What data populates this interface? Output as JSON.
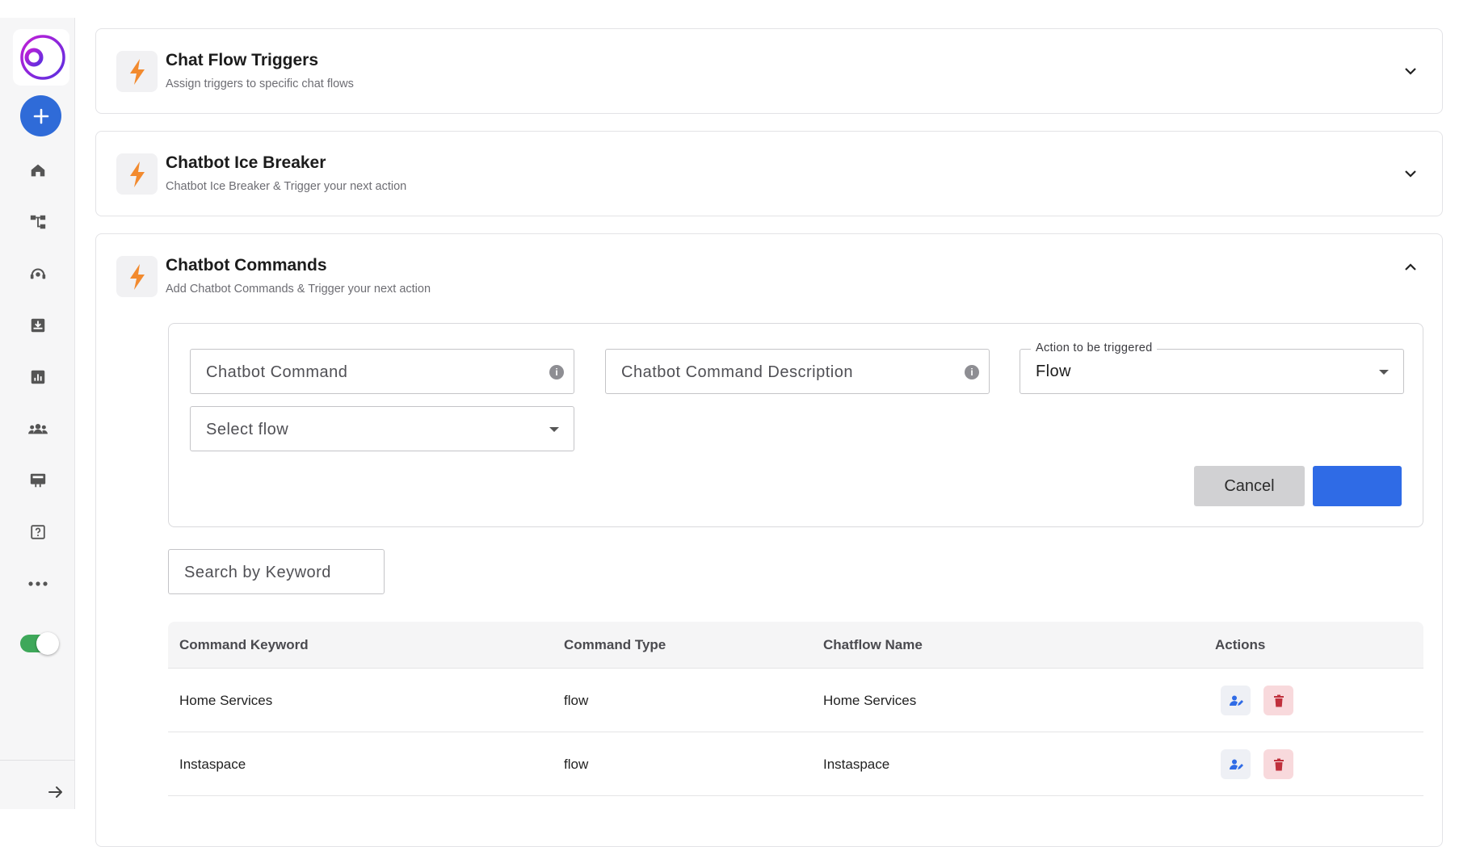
{
  "sidebar": {
    "items": [
      "home-icon",
      "flow-builder-icon",
      "support-agent-icon",
      "inbox-icon",
      "analytics-icon",
      "contacts-icon",
      "broadcast-icon",
      "help-icon",
      "more-icon"
    ],
    "toggle_on": true
  },
  "cards": [
    {
      "title": "Chat Flow Triggers",
      "subtitle": "Assign triggers to specific chat flows",
      "expanded": false
    },
    {
      "title": "Chatbot Ice Breaker",
      "subtitle": "Chatbot Ice Breaker & Trigger your next action",
      "expanded": false
    },
    {
      "title": "Chatbot Commands",
      "subtitle": "Add Chatbot Commands & Trigger your next action",
      "expanded": true
    }
  ],
  "form": {
    "command_placeholder": "Chatbot Command",
    "description_placeholder": "Chatbot Command Description",
    "action_label": "Action to be triggered",
    "action_value": "Flow",
    "flow_placeholder": "Select flow",
    "cancel_label": "Cancel",
    "submit_label": ""
  },
  "search": {
    "placeholder": "Search by Keyword"
  },
  "table": {
    "headers": [
      "Command Keyword",
      "Command Type",
      "Chatflow Name",
      "Actions"
    ],
    "rows": [
      {
        "keyword": "Home Services",
        "type": "flow",
        "chatflow": "Home Services"
      },
      {
        "keyword": "Instaspace",
        "type": "flow",
        "chatflow": "Instaspace"
      }
    ]
  },
  "colors": {
    "accent": "#2f6be6",
    "bolt": "#f28a2e",
    "delete": "#c0303c",
    "toggle": "#3ea85a"
  }
}
